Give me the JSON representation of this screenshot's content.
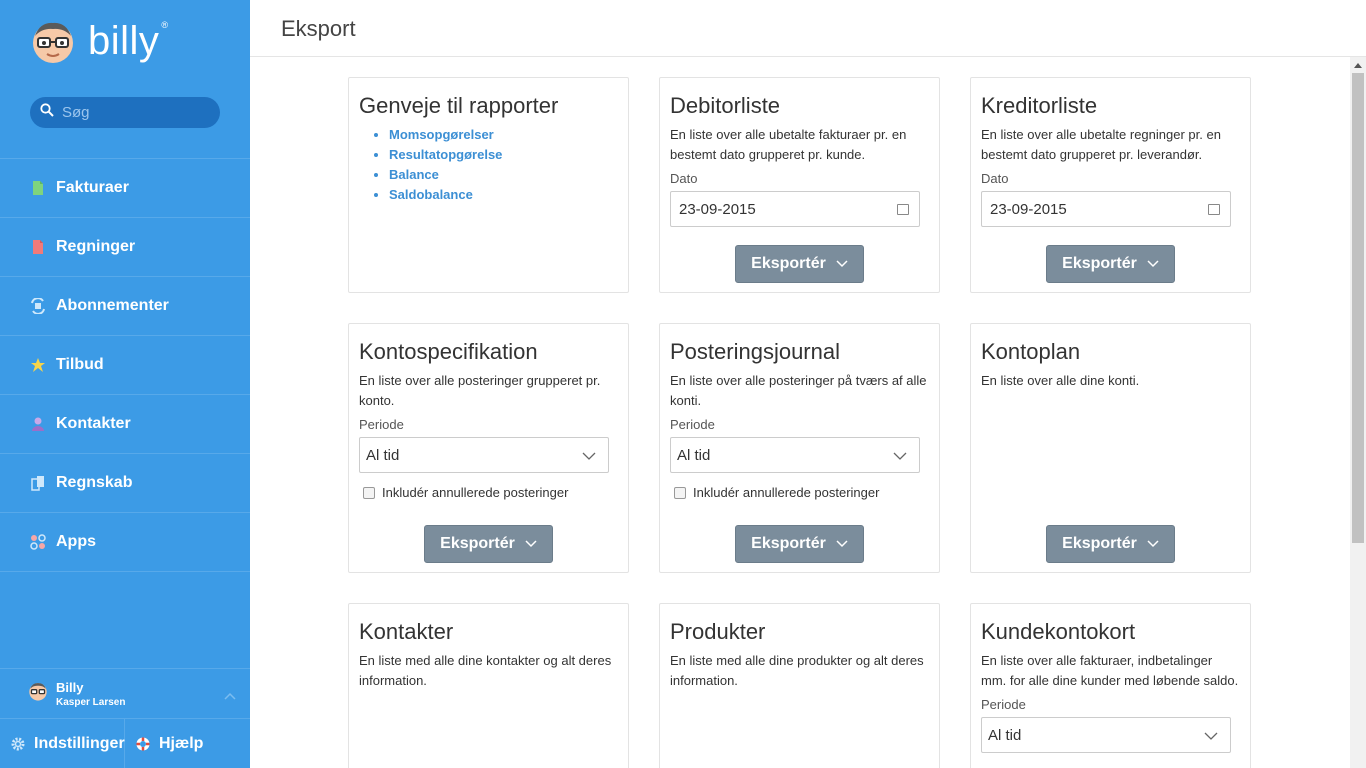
{
  "app": {
    "name": "billy",
    "reg": "®"
  },
  "search": {
    "placeholder": "Søg"
  },
  "nav": [
    {
      "label": "Fakturaer",
      "icon": "invoice-icon",
      "color": "#7ed47e"
    },
    {
      "label": "Regninger",
      "icon": "bill-icon",
      "color": "#f07a7a"
    },
    {
      "label": "Abonnementer",
      "icon": "subscription-icon",
      "color": "#9ed0f5"
    },
    {
      "label": "Tilbud",
      "icon": "star-icon",
      "color": "#f7d44a"
    },
    {
      "label": "Kontakter",
      "icon": "person-icon",
      "color": "#b48ad8"
    },
    {
      "label": "Regnskab",
      "icon": "books-icon",
      "color": "#9ed0f5"
    },
    {
      "label": "Apps",
      "icon": "apps-icon",
      "color": "#f7a7a7"
    }
  ],
  "user": {
    "org": "Billy",
    "name": "Kasper Larsen"
  },
  "bottom": {
    "settings": "Indstillinger",
    "help": "Hjælp"
  },
  "header": {
    "title": "Eksport"
  },
  "cards": {
    "shortcuts": {
      "title": "Genveje til rapporter",
      "links": [
        "Momsopgørelser",
        "Resultatopgørelse",
        "Balance",
        "Saldobalance"
      ]
    },
    "debtors": {
      "title": "Debitorliste",
      "desc": "En liste over alle ubetalte fakturaer pr. en bestemt dato grupperet pr. kunde.",
      "label": "Dato",
      "date": "23-09-2015",
      "button": "Eksportér"
    },
    "creditors": {
      "title": "Kreditorliste",
      "desc": "En liste over alle ubetalte regninger pr. en bestemt dato grupperet pr. leverandør.",
      "label": "Dato",
      "date": "23-09-2015",
      "button": "Eksportér"
    },
    "account_spec": {
      "title": "Kontospecifikation",
      "desc": "En liste over alle posteringer grupperet pr. konto.",
      "label": "Periode",
      "select": "Al tid",
      "checkbox": "Inkludér annullerede posteringer",
      "button": "Eksportér"
    },
    "journal": {
      "title": "Posteringsjournal",
      "desc": "En liste over alle posteringer på tværs af alle konti.",
      "label": "Periode",
      "select": "Al tid",
      "checkbox": "Inkludér annullerede posteringer",
      "button": "Eksportér"
    },
    "chart_of_accounts": {
      "title": "Kontoplan",
      "desc": "En liste over alle dine konti.",
      "button": "Eksportér"
    },
    "contacts": {
      "title": "Kontakter",
      "desc": "En liste med alle dine kontakter og alt deres information."
    },
    "products": {
      "title": "Produkter",
      "desc": "En liste med alle dine produkter og alt deres information."
    },
    "customer_card": {
      "title": "Kundekontokort",
      "desc": "En liste over alle fakturaer, indbetalinger mm. for alle dine kunder med løbende saldo.",
      "label": "Periode",
      "select": "Al tid"
    }
  }
}
